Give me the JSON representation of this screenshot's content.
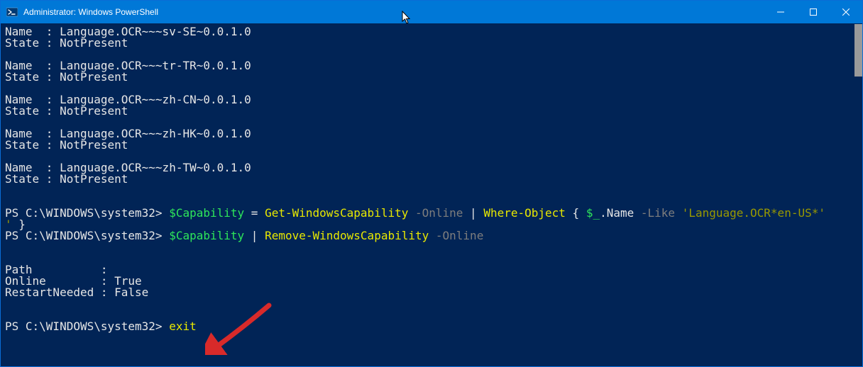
{
  "titlebar": {
    "title": "Administrator: Windows PowerShell"
  },
  "terminal": {
    "caps": [
      {
        "name": "Language.OCR~~~sv-SE~0.0.1.0",
        "state": "NotPresent"
      },
      {
        "name": "Language.OCR~~~tr-TR~0.0.1.0",
        "state": "NotPresent"
      },
      {
        "name": "Language.OCR~~~zh-CN~0.0.1.0",
        "state": "NotPresent"
      },
      {
        "name": "Language.OCR~~~zh-HK~0.0.1.0",
        "state": "NotPresent"
      },
      {
        "name": "Language.OCR~~~zh-TW~0.0.1.0",
        "state": "NotPresent"
      }
    ],
    "prompt": "PS C:\\WINDOWS\\system32>",
    "cmd1": {
      "var": "$Capability",
      "eq": " = ",
      "cmdlet": "Get-WindowsCapability",
      "param": "-Online",
      "pipe": " | ",
      "where": "Where-Object",
      "brace_open": " { ",
      "dollar_under": "$_",
      "dot_name": ".Name ",
      "like": "-Like",
      "str": " 'Language.OCR*en-US*'",
      "brace_close": " }"
    },
    "cmd2": {
      "var": "$Capability",
      "pipe": " | ",
      "cmdlet": "Remove-WindowsCapability",
      "param": "-Online"
    },
    "result": {
      "path_label": "Path          :",
      "online_label": "Online        : ",
      "online_value": "True",
      "restart_label": "RestartNeeded : ",
      "restart_value": "False"
    },
    "cmd3": "exit"
  }
}
